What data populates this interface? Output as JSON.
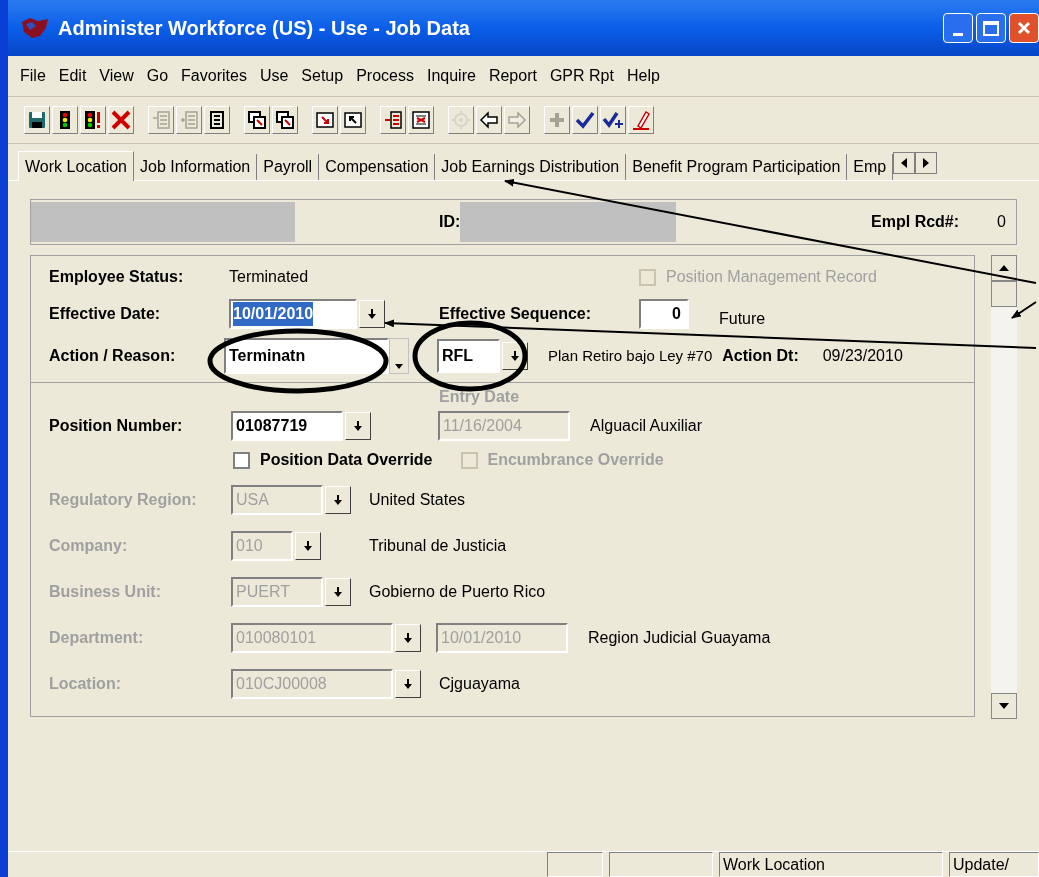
{
  "window": {
    "title": "Administer Workforce (US) - Use - Job Data"
  },
  "menu": [
    "File",
    "Edit",
    "View",
    "Go",
    "Favorites",
    "Use",
    "Setup",
    "Process",
    "Inquire",
    "Report",
    "GPR Rpt",
    "Help"
  ],
  "toolbar": [
    [
      {
        "kind": "save",
        "disabled": false
      },
      {
        "kind": "traffic-light",
        "disabled": false
      },
      {
        "kind": "traffic-light-alert",
        "disabled": false
      },
      {
        "kind": "delete",
        "disabled": false
      }
    ],
    [
      {
        "kind": "list-insert",
        "disabled": true
      },
      {
        "kind": "list-add",
        "disabled": true
      },
      {
        "kind": "list",
        "disabled": false
      }
    ],
    [
      {
        "kind": "window-next",
        "disabled": false
      },
      {
        "kind": "window-prev",
        "disabled": false
      }
    ],
    [
      {
        "kind": "arrow-down-right",
        "disabled": false
      },
      {
        "kind": "arrow-up-left",
        "disabled": false
      }
    ],
    [
      {
        "kind": "row-insert",
        "disabled": false
      },
      {
        "kind": "row-delete",
        "disabled": false
      }
    ],
    [
      {
        "kind": "gear",
        "disabled": true
      },
      {
        "kind": "arrow-left",
        "disabled": false
      },
      {
        "kind": "arrow-right",
        "disabled": true
      }
    ],
    [
      {
        "kind": "plus",
        "disabled": true
      },
      {
        "kind": "check",
        "disabled": false
      },
      {
        "kind": "check-plus",
        "disabled": false
      },
      {
        "kind": "pencil",
        "disabled": false
      }
    ]
  ],
  "tabs": [
    {
      "label": "Work Location",
      "selected": true
    },
    {
      "label": "Job Information",
      "selected": false
    },
    {
      "label": "Payroll",
      "selected": false
    },
    {
      "label": "Compensation",
      "selected": false
    },
    {
      "label": "Job Earnings Distribution",
      "selected": false
    },
    {
      "label": "Benefit Program Participation",
      "selected": false
    },
    {
      "label": "Emp",
      "selected": false
    }
  ],
  "header": {
    "id_label": "ID:",
    "empl_rcd_label": "Empl Rcd#:",
    "empl_rcd": "0"
  },
  "employee_status": {
    "label": "Employee Status:",
    "value": "Terminated"
  },
  "position_management_record": {
    "label": "Position Management Record",
    "checked": false,
    "disabled": true
  },
  "effective_date": {
    "label": "Effective Date:",
    "value": "10/01/2010",
    "selected": true
  },
  "effective_sequence": {
    "label": "Effective Sequence:",
    "value": "0",
    "note": "Future"
  },
  "action_reason": {
    "label": "Action / Reason:",
    "action": "Terminatn",
    "reason": "RFL",
    "reason_description": "Plan Retiro bajo Ley #70",
    "action_dt_label": "Action Dt:",
    "action_dt": "09/23/2010"
  },
  "entry_date_label": "Entry Date",
  "position_number": {
    "label": "Position Number:",
    "value": "01087719",
    "entry_date": "11/16/2004",
    "description": "Alguacil Auxiliar"
  },
  "position_data_override": {
    "label": "Position Data Override",
    "checked": false,
    "disabled": false
  },
  "encumbrance_override": {
    "label": "Encumbrance Override",
    "checked": false,
    "disabled": true
  },
  "fields": [
    {
      "label": "Regulatory Region:",
      "value": "USA",
      "description": "United States"
    },
    {
      "label": "Company:",
      "value": "010",
      "description": "Tribunal de Justicia"
    },
    {
      "label": "Business Unit:",
      "value": "PUERT",
      "description": "Gobierno de Puerto Rico"
    },
    {
      "label": "Department:",
      "value": "010080101",
      "date": "10/01/2010",
      "description": "Region Judicial Guayama"
    },
    {
      "label": "Location:",
      "value": "010CJ00008",
      "description": "Cjguayama"
    }
  ],
  "status_bar": [
    "Work Location",
    "Update/"
  ]
}
